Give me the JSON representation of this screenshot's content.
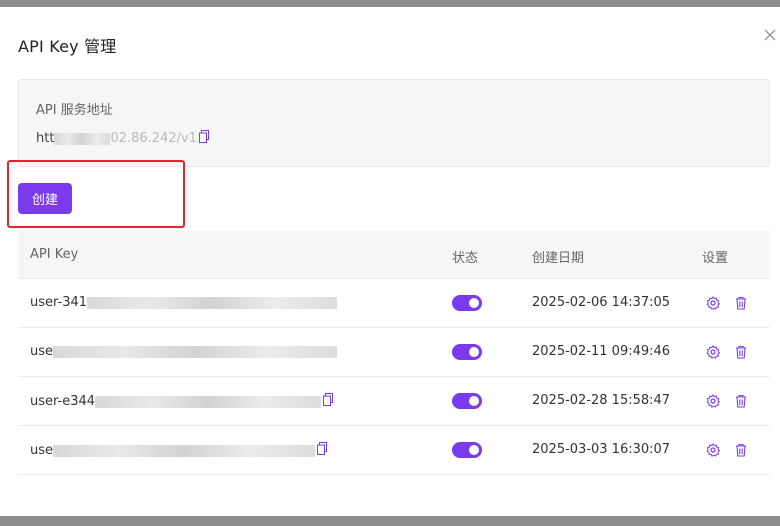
{
  "dialog": {
    "title": "API Key 管理",
    "close_icon": "close-icon"
  },
  "endpoint": {
    "label": "API 服务地址",
    "url_prefix": "htt",
    "url_visible": "02.86.242/v1",
    "copy_icon": "copy-icon"
  },
  "actions": {
    "create_label": "创建"
  },
  "table": {
    "headers": {
      "key": "API Key",
      "status": "状态",
      "created": "创建日期",
      "settings": "设置"
    },
    "rows": [
      {
        "key_prefix": "user-341",
        "created": "2025-02-06 14:37:05",
        "enabled": true
      },
      {
        "key_prefix": "use",
        "created": "2025-02-11 09:49:46",
        "enabled": true
      },
      {
        "key_prefix": "user-e344",
        "created": "2025-02-28 15:58:47",
        "enabled": true
      },
      {
        "key_prefix": "use",
        "created": "2025-03-03 16:30:07",
        "enabled": true
      }
    ]
  },
  "colors": {
    "accent": "#7c3aed",
    "highlight": "#e5252a"
  }
}
